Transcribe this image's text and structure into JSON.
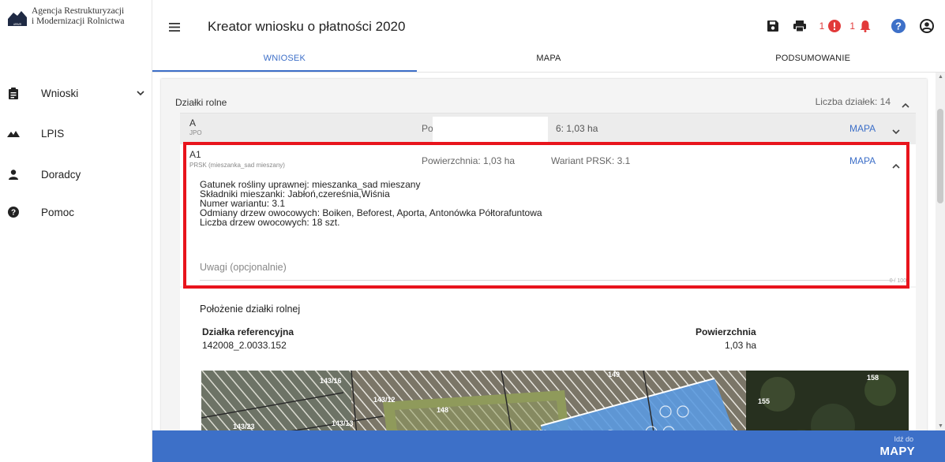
{
  "sidebar": {
    "logo_line1": "Agencja Restrukturyzacji",
    "logo_line2": "i Modernizacji Rolnictwa",
    "logo_mark_text": "ARiMR",
    "items": [
      {
        "label": "Wnioski",
        "icon": "clipboard-icon",
        "expandable": true
      },
      {
        "label": "LPIS",
        "icon": "mountains-icon"
      },
      {
        "label": "Doradcy",
        "icon": "person-icon"
      },
      {
        "label": "Pomoc",
        "icon": "help-circle-icon"
      }
    ]
  },
  "header": {
    "title": "Kreator wniosku o płatności 2020",
    "error_count": "1",
    "notification_count": "1",
    "icons": [
      "save-icon",
      "print-icon",
      "error-icon",
      "bell-icon",
      "help-icon",
      "account-icon"
    ]
  },
  "tabs": [
    {
      "label": "WNIOSEK",
      "active": true
    },
    {
      "label": "MAPA",
      "active": false
    },
    {
      "label": "PODSUMOWANIE",
      "active": false
    }
  ],
  "panel": {
    "title": "Działki rolne",
    "count_label": "Liczba działek: 14"
  },
  "row_a": {
    "name": "A",
    "sub": "JPO",
    "po": "Po",
    "area": "6: 1,03 ha",
    "map_label": "MAPA"
  },
  "row_a1": {
    "name": "A1",
    "sub": "PRSK (mieszanka_sad mieszany)",
    "area": "Powierzchnia: 1,03 ha",
    "variant": "Wariant PRSK: 3.1",
    "map_label": "MAPA",
    "details": [
      "Gatunek rośliny uprawnej: mieszanka_sad mieszany",
      "Składniki mieszanki: Jabłoń,czereśnia,Wiśnia",
      "Numer wariantu: 3.1",
      "Odmiany drzew owocowych: Boiken, Beforest, Aporta, Antonówka Półtorafuntowa",
      "Liczba drzew owocowych: 18 szt."
    ],
    "notes_placeholder": "Uwagi (opcjonalnie)",
    "char_counter": "0 / 1000"
  },
  "polozenie": {
    "title": "Położenie działki rolnej",
    "col1_header": "Działka referencyjna",
    "col1_value": "142008_2.0033.152",
    "col2_header": "Powierzchnia",
    "col2_value": "1,03 ha",
    "map_labels": [
      "143/16",
      "143/12",
      "148",
      "149",
      "143/23",
      "143/13",
      "150",
      "155",
      "158"
    ]
  },
  "footer": {
    "small": "Idź do",
    "big": "MAPY"
  },
  "colors": {
    "accent": "#3d70c8",
    "highlight": "#e8141c",
    "error": "#e23a3a"
  }
}
